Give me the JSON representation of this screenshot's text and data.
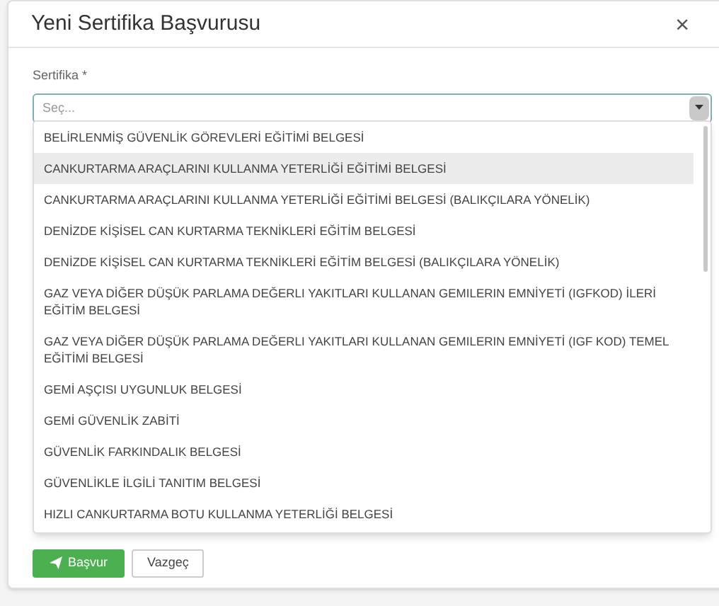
{
  "dialog": {
    "title": "Yeni Sertifika Başvurusu",
    "close": "×"
  },
  "field": {
    "label": "Sertifika *",
    "placeholder": "Seç..."
  },
  "options": [
    {
      "label": "BELİRLENMİŞ GÜVENLİK GÖREVLERİ EĞİTİMİ BELGESİ",
      "selected": false
    },
    {
      "label": "CANKURTARMA ARAÇLARINI KULLANMA YETERLİĞİ EĞİTİMİ BELGESİ",
      "selected": true
    },
    {
      "label": "CANKURTARMA ARAÇLARINI KULLANMA YETERLİĞİ EĞİTİMİ BELGESİ (BALIKÇILARA YÖNELİK)",
      "selected": false
    },
    {
      "label": "DENİZDE KİŞİSEL CAN KURTARMA TEKNİKLERİ EĞİTİM BELGESİ",
      "selected": false
    },
    {
      "label": "DENİZDE KİŞİSEL CAN KURTARMA TEKNİKLERİ EĞİTİM BELGESİ (BALIKÇILARA YÖNELİK)",
      "selected": false
    },
    {
      "label": "GAZ VEYA DİĞER DÜŞÜK PARLAMA DEĞERLI YAKITLARI KULLANAN GEMILERIN EMNİYETİ (IGFKOD) İLERİ EĞİTİM BELGESİ",
      "selected": false
    },
    {
      "label": "GAZ VEYA DİĞER DÜŞÜK PARLAMA DEĞERLI YAKITLARI KULLANAN GEMILERIN EMNİYETİ (IGF KOD) TEMEL EĞİTİMİ BELGESİ",
      "selected": false
    },
    {
      "label": "GEMİ AŞÇISI UYGUNLUK BELGESİ",
      "selected": false
    },
    {
      "label": "GEMİ GÜVENLİK ZABİTİ",
      "selected": false
    },
    {
      "label": "GÜVENLİK FARKINDALIK BELGESİ",
      "selected": false
    },
    {
      "label": "GÜVENLİKLE İLGİLİ TANITIM BELGESİ",
      "selected": false
    },
    {
      "label": "HIZLI CANKURTARMA BOTU KULLANMA YETERLİĞİ BELGESİ",
      "selected": false
    }
  ],
  "buttons": [
    {
      "label": "Başvur",
      "kind": "primary"
    },
    {
      "label": "Vazgeç",
      "kind": "default"
    }
  ]
}
